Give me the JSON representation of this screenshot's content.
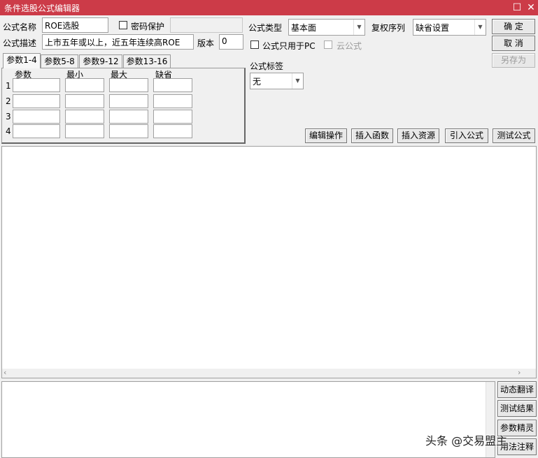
{
  "window": {
    "title": "条件选股公式编辑器",
    "maximize_icon": "maximize-icon",
    "close_icon": "close-icon"
  },
  "form": {
    "name_label": "公式名称",
    "name_value": "ROE选股",
    "password_label": "密码保护",
    "password_value": "",
    "desc_label": "公式描述",
    "desc_value": "上市五年或以上，近五年连续高ROE",
    "version_label": "版本",
    "version_value": "0",
    "type_label": "公式类型",
    "type_value": "基本面",
    "restore_label": "复权序列",
    "restore_value": "缺省设置",
    "pc_only_label": "公式只用于PC",
    "cloud_label": "云公式",
    "tag_label": "公式标签",
    "tag_value": "无"
  },
  "buttons": {
    "ok": "确  定",
    "cancel": "取  消",
    "save_as": "另存为",
    "edit_ops": "编辑操作",
    "insert_func": "插入函数",
    "insert_res": "插入资源",
    "import_formula": "引入公式",
    "test_formula": "测试公式"
  },
  "param_tabs": [
    "参数1-4",
    "参数5-8",
    "参数9-12",
    "参数13-16"
  ],
  "param_headers": [
    "参数",
    "最小",
    "最大",
    "缺省"
  ],
  "param_rows": [
    "1",
    "2",
    "3",
    "4"
  ],
  "side_buttons": [
    "动态翻译",
    "测试结果",
    "参数精灵",
    "用法注释"
  ],
  "watermark": "头条 @交易盟主",
  "colors": {
    "titlebar": "#cc3b48",
    "background": "#f0f0f0"
  }
}
